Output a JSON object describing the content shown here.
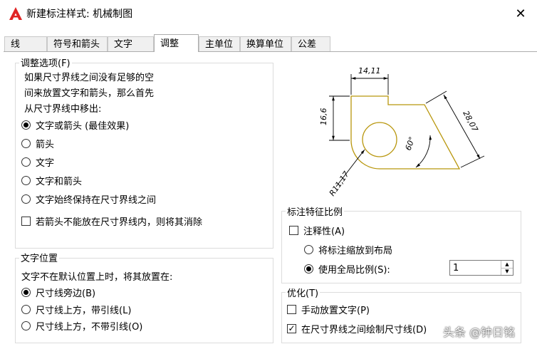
{
  "title": "新建标注样式: 机械制图",
  "icons": {
    "app": "autocad-logo-icon",
    "close": "close-icon"
  },
  "colors": {
    "logo": "#e02424",
    "drawing": "#b8960c"
  },
  "tabs": [
    "线",
    "符号和箭头",
    "文字",
    "调整",
    "主单位",
    "换算单位",
    "公差"
  ],
  "active_tab": "调整",
  "fit_options": {
    "title": "调整选项(F)",
    "description": [
      "如果尺寸界线之间没有足够的空",
      "间来放置文字和箭头，那么首先",
      "从尺寸界线中移出:"
    ],
    "radios": [
      "文字或箭头 (最佳效果)",
      "箭头",
      "文字",
      "文字和箭头",
      "文字始终保持在尺寸界线之间"
    ],
    "selected_index": 0,
    "suppress_label": "若箭头不能放在尺寸界线内，则将其消除",
    "suppress_checked": false
  },
  "text_placement": {
    "title": "文字位置",
    "description": "文字不在默认位置上时，将其放置在:",
    "radios": [
      "尺寸线旁边(B)",
      "尺寸线上方，带引线(L)",
      "尺寸线上方，不带引线(O)"
    ],
    "selected_index": 0
  },
  "preview": {
    "dim_top": "14,11",
    "dim_left": "16,6",
    "dim_right": "28,07",
    "angle": "60°",
    "radius": "R11,17"
  },
  "scale": {
    "title": "标注特征比例",
    "annotative_label": "注释性(A)",
    "annotative_checked": false,
    "radio_layout": "将标注缩放到布局",
    "radio_overall": "使用全局比例(S):",
    "selected": "overall",
    "overall_value": "1"
  },
  "finetune": {
    "title": "优化(T)",
    "manual_label": "手动放置文字(P)",
    "manual_checked": false,
    "draw_dimline_label": "在尺寸界线之间绘制尺寸线(D)",
    "draw_dimline_checked": true
  },
  "watermark": "头条 @钟日铭"
}
